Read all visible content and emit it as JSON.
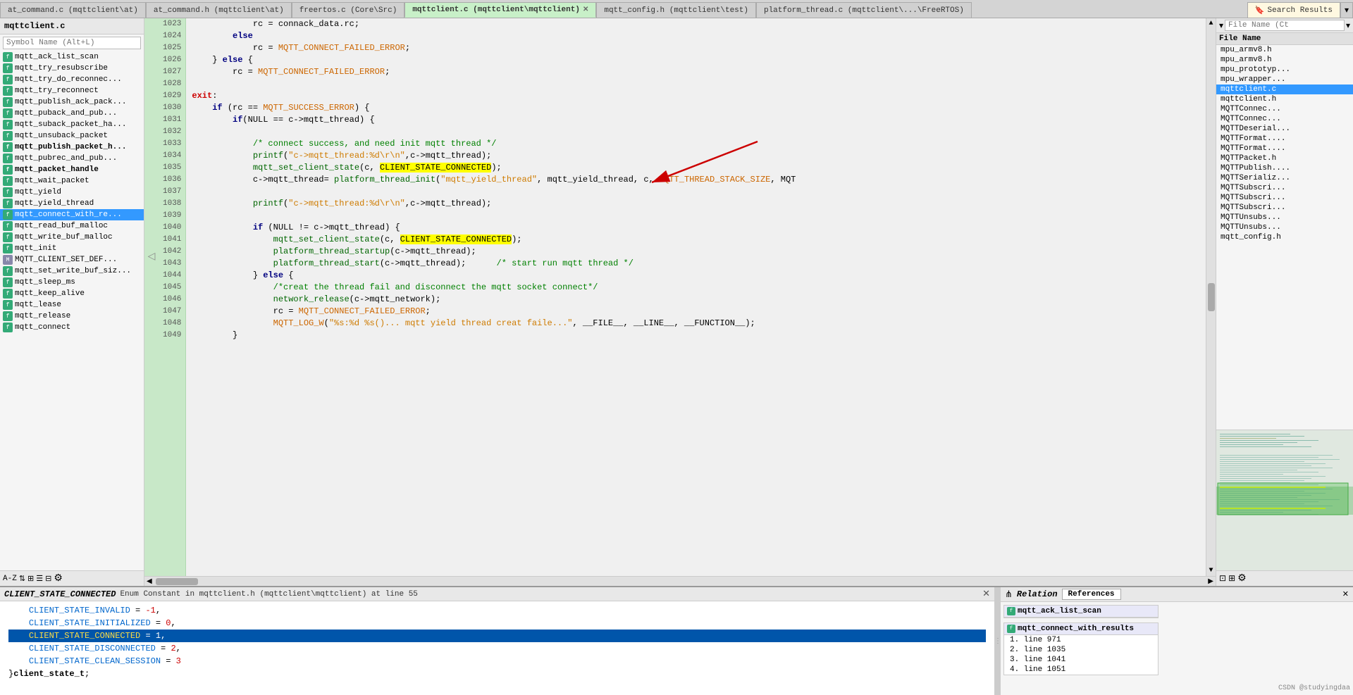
{
  "tabs": [
    {
      "label": "at_command.c (mqttclient\\at)",
      "active": false,
      "closable": false
    },
    {
      "label": "at_command.h (mqttclient\\at)",
      "active": false,
      "closable": false
    },
    {
      "label": "freertos.c (Core\\Src)",
      "active": false,
      "closable": false
    },
    {
      "label": "mqttclient.c (mqttclient\\mqttclient)",
      "active": true,
      "closable": true
    },
    {
      "label": "mqtt_config.h (mqttclient\\test)",
      "active": false,
      "closable": false
    },
    {
      "label": "platform_thread.c (mqttclient\\...\\FreeRTOS)",
      "active": false,
      "closable": false
    },
    {
      "label": "Search Results",
      "active": false,
      "closable": false,
      "special": true
    }
  ],
  "sidebar": {
    "title": "mqttclient.c",
    "search_placeholder": "Symbol Name (Alt+L)",
    "symbols": [
      {
        "name": "mqtt_ack_list_scan",
        "bold": false
      },
      {
        "name": "mqtt_try_resubscribe",
        "bold": false
      },
      {
        "name": "mqtt_try_do_reconnect",
        "bold": false
      },
      {
        "name": "mqtt_try_reconnect",
        "bold": false
      },
      {
        "name": "mqtt_publish_ack_pack",
        "bold": false
      },
      {
        "name": "mqtt_puback_and_pub",
        "bold": false
      },
      {
        "name": "mqtt_suback_packet_ha",
        "bold": false
      },
      {
        "name": "mqtt_unsuback_packet",
        "bold": false
      },
      {
        "name": "mqtt_publish_packet_h",
        "bold": true
      },
      {
        "name": "mqtt_pubrec_and_pub",
        "bold": false
      },
      {
        "name": "mqtt_packet_handle",
        "bold": true
      },
      {
        "name": "mqtt_wait_packet",
        "bold": false
      },
      {
        "name": "mqtt_yield",
        "bold": false
      },
      {
        "name": "mqtt_yield_thread",
        "bold": false
      },
      {
        "name": "mqtt_connect_with_re",
        "bold": false,
        "active": true
      },
      {
        "name": "mqtt_read_buf_malloc",
        "bold": false
      },
      {
        "name": "mqtt_write_buf_malloc",
        "bold": false
      },
      {
        "name": "mqtt_init",
        "bold": false
      },
      {
        "name": "MQTT_CLIENT_SET_DEF",
        "bold": false
      },
      {
        "name": "mqtt_set_write_buf_siz",
        "bold": false
      },
      {
        "name": "mqtt_sleep_ms",
        "bold": false
      },
      {
        "name": "mqtt_keep_alive",
        "bold": false
      },
      {
        "name": "mqtt_lease",
        "bold": false
      },
      {
        "name": "mqtt_release",
        "bold": false
      },
      {
        "name": "mqtt_connect",
        "bold": false
      }
    ]
  },
  "code": {
    "lines": [
      {
        "num": 1023,
        "content": "    rc = connack_data.rc;",
        "type": "normal"
      },
      {
        "num": 1024,
        "content": "else",
        "type": "keyword",
        "indent": 8
      },
      {
        "num": 1025,
        "content": "    rc = MQTT_CONNECT_FAILED_ERROR;",
        "type": "macro",
        "indent": 12
      },
      {
        "num": 1026,
        "content": "} else {",
        "type": "normal",
        "indent": 4
      },
      {
        "num": 1027,
        "content": "    rc = MQTT_CONNECT_FAILED_ERROR;",
        "type": "macro",
        "indent": 8
      },
      {
        "num": 1028,
        "content": "",
        "type": "empty"
      },
      {
        "num": 1029,
        "content": "exit:",
        "type": "exit"
      },
      {
        "num": 1030,
        "content": "    if (rc == MQTT_SUCCESS_ERROR) {",
        "type": "normal"
      },
      {
        "num": 1031,
        "content": "        if(NULL == c->mqtt_thread) {",
        "type": "normal"
      },
      {
        "num": 1032,
        "content": "",
        "type": "empty"
      },
      {
        "num": 1033,
        "content": "            /* connect success, and need init mqtt thread */",
        "type": "comment"
      },
      {
        "num": 1034,
        "content": "            printf(\"c->mqtt_thread:%d\\r\\n\",c->mqtt_thread);",
        "type": "normal"
      },
      {
        "num": 1035,
        "content": "            mqtt_set_client_state(c, CLIENT_STATE_CONNECTED);",
        "type": "highlighted"
      },
      {
        "num": 1036,
        "content": "            c->mqtt_thread= platform_thread_init(\"mqtt_yield_thread\", mqtt_yield_thread, c, MQTT_THREAD_STACK_SIZE, MQT",
        "type": "normal"
      },
      {
        "num": 1037,
        "content": "",
        "type": "empty"
      },
      {
        "num": 1038,
        "content": "            printf(\"c->mqtt_thread:%d\\r\\n\",c->mqtt_thread);",
        "type": "normal"
      },
      {
        "num": 1039,
        "content": "",
        "type": "empty"
      },
      {
        "num": 1040,
        "content": "            if (NULL != c->mqtt_thread) {",
        "type": "normal"
      },
      {
        "num": 1041,
        "content": "                mqtt_set_client_state(c, CLIENT_STATE_CONNECTED);",
        "type": "highlighted2"
      },
      {
        "num": 1042,
        "content": "                platform_thread_startup(c->mqtt_thread);",
        "type": "normal"
      },
      {
        "num": 1043,
        "content": "                platform_thread_start(c->mqtt_thread);    /* start run mqtt thread */",
        "type": "cmt"
      },
      {
        "num": 1044,
        "content": "            } else {",
        "type": "normal"
      },
      {
        "num": 1045,
        "content": "                /*creat the thread fail and disconnect the mqtt socket connect*/",
        "type": "comment"
      },
      {
        "num": 1046,
        "content": "                network_release(c->mqtt_network);",
        "type": "normal"
      },
      {
        "num": 1047,
        "content": "                rc = MQTT_CONNECT_FAILED_ERROR;",
        "type": "macro"
      },
      {
        "num": 1048,
        "content": "                MQTT_LOG_W(\"%s:%d %s()... mqtt yield thread creat faile...\", __FILE__, __LINE__, __FUNCTION__);",
        "type": "normal"
      },
      {
        "num": 1049,
        "content": "        }",
        "type": "normal"
      }
    ]
  },
  "right_panel": {
    "filter_placeholder": "File Name (Ct",
    "header": "File Name",
    "files": [
      "mpu_armv8.h",
      "mpu_armv8.h",
      "mpu_prototyp",
      "mpu_wrapper",
      "mqttclient.c",
      "mqttclient.h",
      "MQTTConnec",
      "MQTTConnec",
      "MQTTDeserial",
      "MQTTFormat.",
      "MQTTFormat.",
      "MQTTPacket.h",
      "MQTTPublish.",
      "MQTTSerializ",
      "MQTTSubscri",
      "MQTTSubscri",
      "MQTTSubscri",
      "MQTTUnsubs",
      "MQTTUnsubs",
      "mqtt_config.h"
    ]
  },
  "bottom": {
    "title": "CLIENT_STATE_CONNECTED",
    "subtitle": "Enum Constant in mqttclient.h (mqttclient\\mqttclient) at line 55",
    "code_lines": [
      "    CLIENT_STATE_INVALID = -1,",
      "    CLIENT_STATE_INITIALIZED = 0,",
      "    CLIENT_STATE_CONNECTED = 1,",
      "    CLIENT_STATE_DISCONNECTED = 2,",
      "    CLIENT_STATE_CLEAN_SESSION = 3",
      "}client_state_t;"
    ],
    "highlighted_line": "    CLIENT_STATE_CONNECTED = 1,"
  },
  "relation": {
    "title": "Relation",
    "tab": "References",
    "boxes": [
      {
        "title": "mqtt_ack_list_scan",
        "items": []
      },
      {
        "title": "mqtt_connect_with_results",
        "items": [
          "1. line 971",
          "2. line 1035",
          "3. line 1041",
          "4. line 1051"
        ]
      }
    ]
  },
  "watermark": "CSDN @studyingdaa"
}
